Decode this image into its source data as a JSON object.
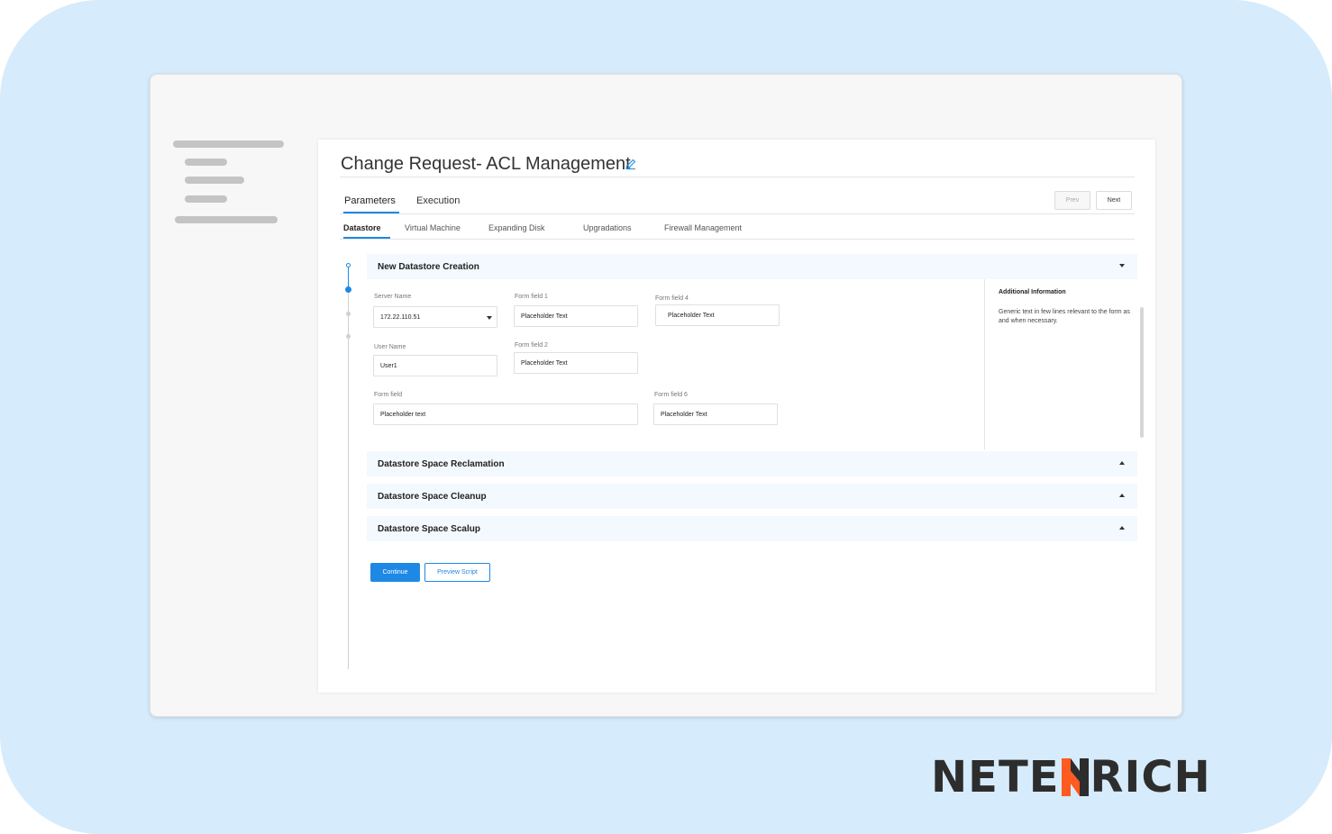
{
  "page": {
    "title": "Change Request- ACL Management"
  },
  "top_tabs": [
    {
      "label": "Parameters",
      "active": true
    },
    {
      "label": "Execution",
      "active": false
    }
  ],
  "nav": {
    "prev_label": "Prev",
    "next_label": "Next"
  },
  "sub_tabs": [
    {
      "label": "Datastore",
      "active": true
    },
    {
      "label": "Virtual Machine",
      "active": false
    },
    {
      "label": "Expanding Disk",
      "active": false
    },
    {
      "label": "Upgradations",
      "active": false
    },
    {
      "label": "Firewall Management",
      "active": false
    }
  ],
  "sections": [
    {
      "title": "New Datastore Creation",
      "expanded": true
    },
    {
      "title": "Datastore Space Reclamation",
      "expanded": false
    },
    {
      "title": "Datastore Space Cleanup",
      "expanded": false
    },
    {
      "title": "Datastore Space Scalup",
      "expanded": false
    }
  ],
  "form": {
    "server_name": {
      "label": "Server Name",
      "value": "172.22.110.51"
    },
    "user_name": {
      "label": "User Name",
      "value": "User1"
    },
    "form_field": {
      "label": "Form field",
      "value": "Placeholder text"
    },
    "form_field_1": {
      "label": "Form field 1",
      "value": "Placeholder Text"
    },
    "form_field_2": {
      "label": "Form field 2",
      "value": "Placeholder Text"
    },
    "form_field_4": {
      "label": "Form field 4",
      "value": "Placeholder Text"
    },
    "form_field_6": {
      "label": "Form field 6",
      "value": "Placeholder Text"
    }
  },
  "info": {
    "title": "Additional Information",
    "text": "Generic text in few lines relevant to the form as and when necessary."
  },
  "actions": {
    "continue_label": "Continue",
    "preview_label": "Preview Script"
  },
  "brand": {
    "logo_left": "NETE",
    "logo_right": "RICH",
    "accent_color": "#ff5a1f",
    "primary_color": "#1e88e5"
  }
}
